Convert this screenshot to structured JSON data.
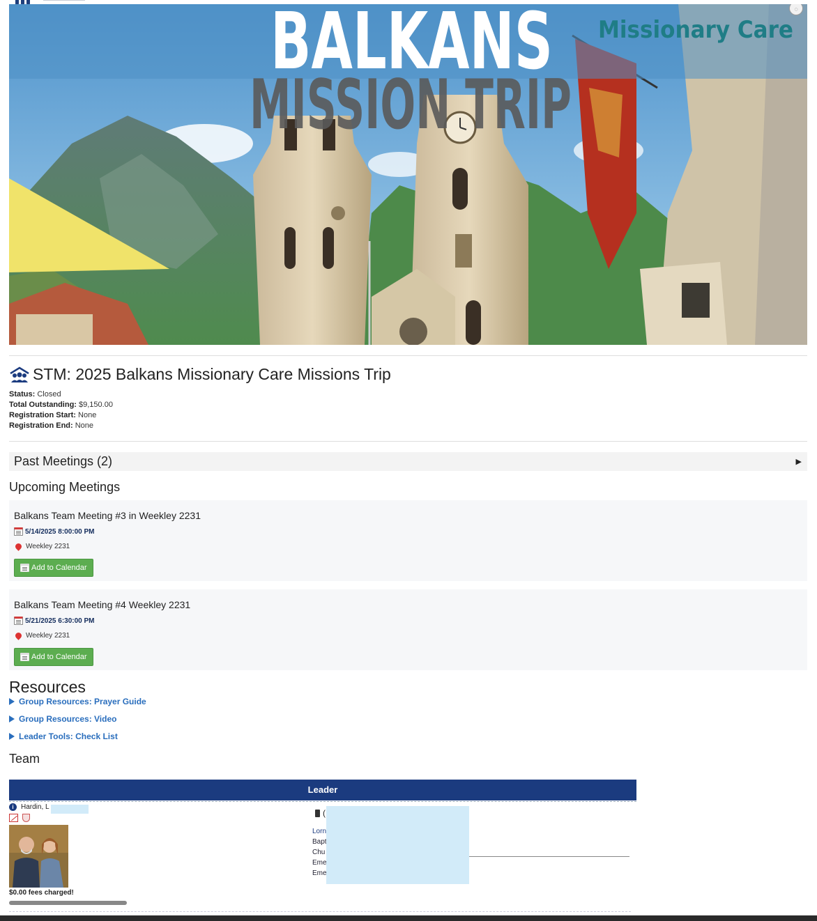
{
  "banner": {
    "headline_top": "BALKANS",
    "headline_bottom": "MISSION TRIP",
    "brand": "Missionary Care"
  },
  "trip": {
    "title": "STM: 2025 Balkans Missionary Care Missions Trip",
    "status_label": "Status:",
    "status_value": "Closed",
    "outstanding_label": "Total Outstanding:",
    "outstanding_value": "$9,150.00",
    "reg_start_label": "Registration Start:",
    "reg_start_value": "None",
    "reg_end_label": "Registration End:",
    "reg_end_value": "None"
  },
  "past_meetings": {
    "label": "Past Meetings (2)",
    "toggle": "▶"
  },
  "upcoming": {
    "heading": "Upcoming Meetings",
    "meetings": [
      {
        "title": "Balkans Team Meeting #3 in Weekley 2231",
        "date": "5/14/2025 8:00:00 PM",
        "location": "Weekley 2231",
        "button": "Add to Calendar"
      },
      {
        "title": "Balkans Team Meeting #4 Weekley 2231",
        "date": "5/21/2025 6:30:00 PM",
        "location": "Weekley 2231",
        "button": "Add to Calendar"
      }
    ]
  },
  "resources": {
    "heading": "Resources",
    "links": [
      "Group Resources: Prayer Guide",
      "Group Resources: Video",
      "Leader Tools: Check List"
    ]
  },
  "team": {
    "heading": "Team",
    "leader_header": "Leader",
    "member": {
      "name": "Hardin, L",
      "fees": "$0.00 fees charged!",
      "phone_prefix": "(",
      "details": [
        "Lorn",
        "Bapt",
        "Chu",
        "Eme",
        "Eme"
      ]
    }
  },
  "icons": {
    "title_icon": "group-people-icon",
    "calendar": "calendar-icon",
    "pin": "map-pin-icon",
    "info": "info-icon",
    "phone": "phone-icon"
  },
  "colors": {
    "navy": "#1b3b7f",
    "link": "#2a6ebd",
    "button_green": "#5cad50"
  }
}
